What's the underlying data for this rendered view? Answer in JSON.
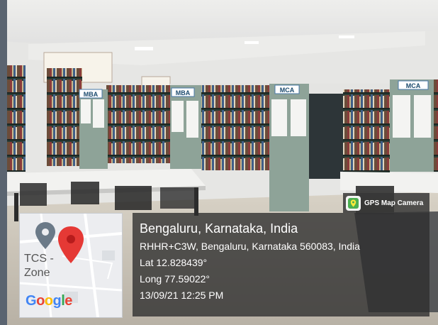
{
  "scene": {
    "section_labels": [
      {
        "text": "MBA"
      },
      {
        "text": "MBA"
      },
      {
        "text": "MCA"
      },
      {
        "text": "MCA"
      }
    ]
  },
  "overlay": {
    "badge": {
      "app_name": "GPS Map Camera",
      "icon": "map-pin-icon"
    },
    "map": {
      "place_label": "TCS -\nZone",
      "logo_text": "Google",
      "pin_icon": "map-pin-icon"
    },
    "location": {
      "city_line": "Bengaluru, Karnataka, India",
      "address_line": "RHHR+C3W, Bengaluru, Karnataka 560083, India",
      "lat_line": "Lat 12.828439°",
      "long_line": "Long 77.59022°",
      "datetime_line": "13/09/21 12:25 PM"
    }
  }
}
